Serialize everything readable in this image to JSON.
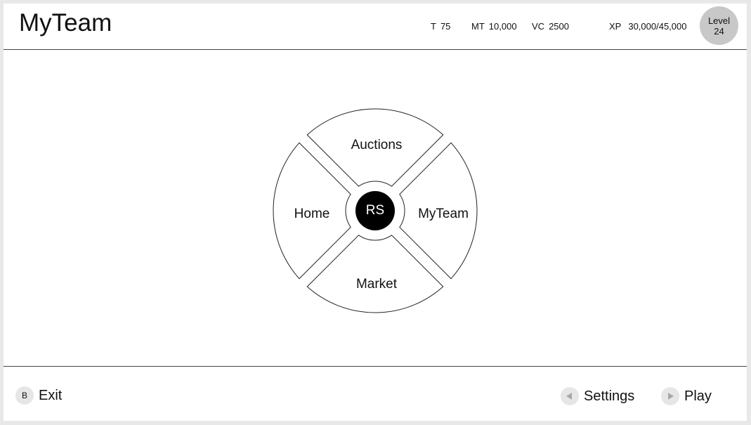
{
  "header": {
    "title": "MyTeam",
    "stats": {
      "t_label": "T",
      "t_value": "75",
      "mt_label": "MT",
      "mt_value": "10,000",
      "vc_label": "VC",
      "vc_value": "2500",
      "xp_label": "XP",
      "xp_value": "30,000/45,000"
    },
    "level": {
      "label": "Level",
      "value": "24"
    }
  },
  "wheel": {
    "top_label": "Auctions",
    "left_label": "Home",
    "right_label": "MyTeam",
    "bottom_label": "Market",
    "center_label": "RS"
  },
  "footer": {
    "exit": {
      "button_glyph": "B",
      "label": "Exit"
    },
    "settings": {
      "icon": "triangle-left-icon",
      "label": "Settings"
    },
    "play": {
      "icon": "triangle-right-icon",
      "label": "Play"
    }
  },
  "colors": {
    "background": "#e8e8e8",
    "panel": "#ffffff",
    "level_badge": "#c8c8c8",
    "button_circle": "#e6e6e6",
    "center_button": "#000000"
  }
}
